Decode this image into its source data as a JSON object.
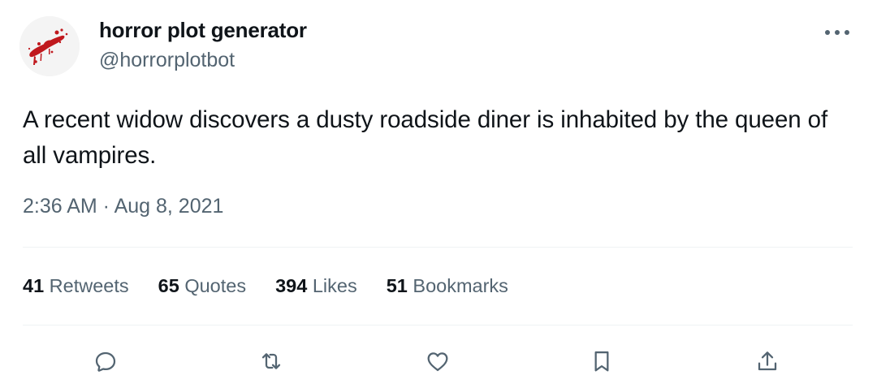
{
  "author": {
    "display_name": "horror plot generator",
    "handle": "@horrorplotbot",
    "avatar_icon": "blood-splatter-avatar"
  },
  "tweet": {
    "text": "A recent widow discovers a dusty roadside diner is inhabited by the queen of all vampires.",
    "time": "2:36 AM",
    "separator": " · ",
    "date": "Aug 8, 2021"
  },
  "stats": {
    "retweets": {
      "count": "41",
      "label": "Retweets"
    },
    "quotes": {
      "count": "65",
      "label": "Quotes"
    },
    "likes": {
      "count": "394",
      "label": "Likes"
    },
    "bookmarks": {
      "count": "51",
      "label": "Bookmarks"
    }
  },
  "actions": [
    "reply-icon",
    "retweet-icon",
    "like-icon",
    "bookmark-icon",
    "share-icon"
  ],
  "colors": {
    "text_primary": "#0f1419",
    "text_secondary": "#536471",
    "divider": "#eff3f4",
    "blood": "#c0191e"
  }
}
